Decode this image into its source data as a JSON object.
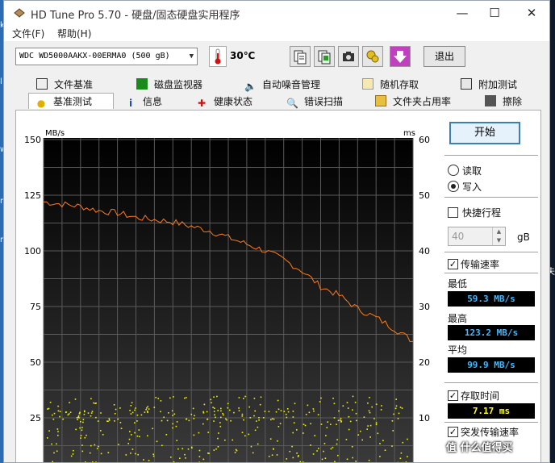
{
  "window": {
    "title": "HD Tune Pro 5.70 - 硬盘/固态硬盘实用程序"
  },
  "menu": [
    "文件(F)",
    "帮助(H)"
  ],
  "toolbar": {
    "drive": "WDC WD5000AAKX-00ERMA0 (500 gB)",
    "temperature": "30℃",
    "exit_label": "退出"
  },
  "tabs_row1": [
    "文件基准",
    "磁盘监视器",
    "自动噪音管理",
    "随机存取",
    "附加测试"
  ],
  "tabs_row2": [
    "基准测试",
    "信息",
    "健康状态",
    "错误扫描",
    "文件夹占用率",
    "擦除"
  ],
  "active_tab": "基准测试",
  "controls": {
    "start_label": "开始",
    "read_label": "读取",
    "write_label": "写入",
    "mode_selected": "写入",
    "short_stroke_label": "快捷行程",
    "short_stroke_checked": false,
    "short_stroke_value": "40",
    "short_stroke_unit": "gB",
    "transfer_rate_label": "传输速率",
    "transfer_rate_checked": true,
    "min_label": "最低",
    "min_value": "59.3 MB/s",
    "max_label": "最高",
    "max_value": "123.2 MB/s",
    "avg_label": "平均",
    "avg_value": "99.9 MB/s",
    "access_time_label": "存取时间",
    "access_time_checked": true,
    "access_time_value": "7.17 ms",
    "burst_rate_label": "突发传输速率",
    "burst_rate_checked": true
  },
  "watermark": "值 什么值得买",
  "desktop_left_chars": [
    "k",
    "l",
    "w",
    "m",
    "n"
  ],
  "desktop_right_char": "夫",
  "colors": {
    "transfer_line": "#ff7a1a",
    "access_dots": "#f2f200",
    "grid": "#5a5a5a",
    "chart_bg_top": "#000000",
    "chart_bg_bottom": "#3a3a3a",
    "readout_blue": "#44b8ff",
    "readout_yellow": "#ffff30"
  },
  "chart_data": {
    "type": "line",
    "ylabel_left": "MB/s",
    "ylabel_right": "ms",
    "ylim_left": [
      0,
      150
    ],
    "ylim_right": [
      0,
      60
    ],
    "yticks_left": [
      150,
      125,
      100,
      75,
      50,
      25
    ],
    "yticks_right": [
      60,
      50,
      40,
      30,
      20,
      10
    ],
    "grid": true,
    "x": [
      0,
      5,
      10,
      15,
      20,
      25,
      30,
      35,
      40,
      45,
      50,
      55,
      60,
      65,
      70,
      75,
      80,
      85,
      90,
      95,
      100
    ],
    "series": [
      {
        "name": "传输速率",
        "axis": "left",
        "values": [
          122,
          121,
          120,
          118,
          117,
          115,
          114,
          113,
          111,
          109,
          106,
          103,
          100,
          96,
          91,
          84,
          80,
          74,
          70,
          65,
          59.3
        ]
      }
    ],
    "access_time_bands_ms": [
      [
        9.5,
        14
      ],
      [
        2,
        12
      ]
    ]
  }
}
